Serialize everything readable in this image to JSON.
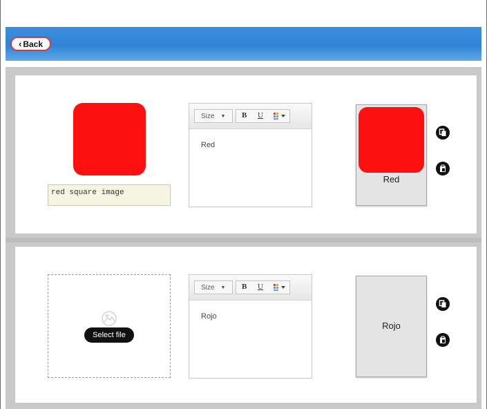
{
  "header": {
    "back_label": "Back"
  },
  "colors": {
    "header_blue": "#2f83d6",
    "square_red": "#ff1010",
    "back_border": "#d43a3a"
  },
  "editor_toolbar": {
    "size_label": "Size",
    "bold_label": "B",
    "underline_label": "U"
  },
  "cards": [
    {
      "image": "red-square",
      "caption_input_value": "red square image",
      "editor_text": "Red",
      "preview_label": "Red"
    },
    {
      "image": null,
      "upload_button_label": "Select file",
      "editor_text": "Rojo",
      "preview_label": "Rojo"
    }
  ],
  "icons": {
    "copy": "copy-icon",
    "paste": "paste-icon",
    "image_placeholder": "image-placeholder-icon"
  }
}
